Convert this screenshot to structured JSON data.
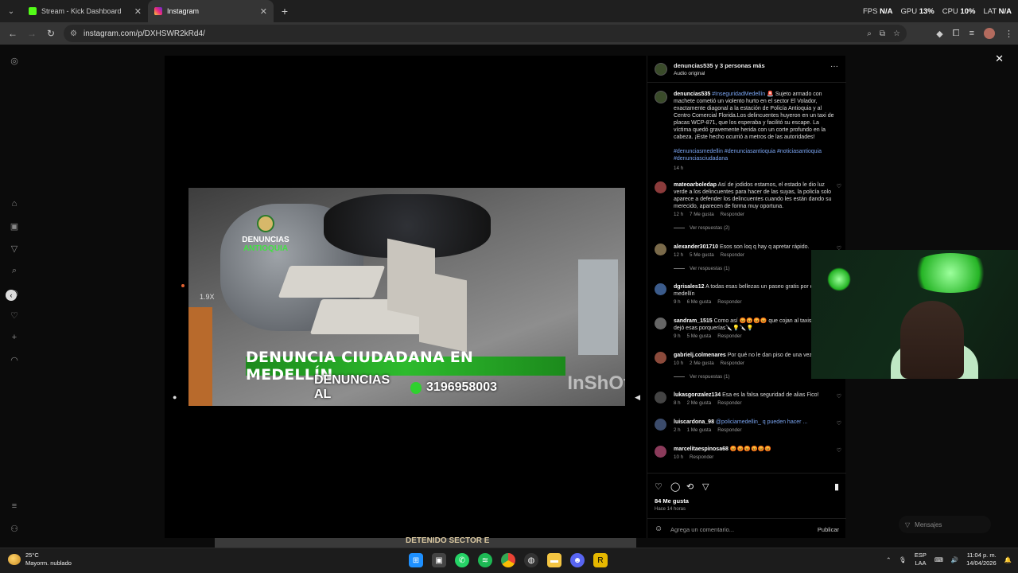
{
  "browser": {
    "tabs": [
      {
        "label": "Stream - Kick Dashboard",
        "favicon_color": "#53fc18",
        "active": false
      },
      {
        "label": "Instagram",
        "favicon_color": "#d62976",
        "active": true
      }
    ],
    "new_tab": "+",
    "url": "instagram.com/p/DXHSWR2kRd4/",
    "stats": {
      "fps_label": "FPS",
      "fps": "N/A",
      "gpu_label": "GPU",
      "gpu": "13%",
      "cpu_label": "CPU",
      "cpu": "10%",
      "lat_label": "LAT",
      "lat": "N/A"
    }
  },
  "player": {
    "speed": "1.9X",
    "watermark_line1": "DENUNCIAS",
    "watermark_line2": "ANTIOQUIA",
    "banner": "DENUNCIA CIUDADANA EN MEDELLÍN",
    "banner_phone_prefix": "DENUNCIAS AL",
    "banner_phone": "3196958003",
    "inshot": "InShOt",
    "bottom_text": "DETENIDO SECTOR E"
  },
  "post": {
    "header_user": "denuncias535 y 3 personas más",
    "header_audio": "Audio original",
    "caption_user": "denuncias535",
    "caption_tag": "#InseguridadMedellín",
    "caption_text": "🚨 Sujeto armado con machete cometió un violento hurto en el sector El Volador, exactamente diagonal a la estación de Policía Antioquia y al Centro Comercial Florida.Los delincuentes huyeron en un taxi de placas WCP-871, que los esperaba y facilitó su escape. La víctima quedó gravemente herida con un corte profundo en la cabeza. ¡Este hecho ocurrió a metros de las autoridades!",
    "caption_hashtags": "#denunciasmedellin #denunciasantioquia #noticiasantioquia #denunciasciudadana",
    "caption_time": "14 h",
    "comments": [
      {
        "user": "mateoarboledap",
        "text": "Así de jodidos estamos, el estado le dio luz verde a los delincuentes para hacer de las suyas, la policía solo aparece a defender los delincuentes cuando les están dando su merecido, aparecen de forma muy oportuna.",
        "time": "12 h",
        "likes": "7 Me gusta",
        "reply": "Responder",
        "replies": "Ver respuestas (2)",
        "color": "#8b3b3b"
      },
      {
        "user": "alexander301710",
        "text": "Esos son loq q hay q apretar rápido.",
        "time": "12 h",
        "likes": "5 Me gusta",
        "reply": "Responder",
        "replies": "Ver respuestas (1)",
        "color": "#7a6a4a"
      },
      {
        "user": "dgrisales12",
        "text": "A todas esas bellezas un paseo gratis por el río medellín",
        "time": "9 h",
        "likes": "6 Me gusta",
        "reply": "Responder",
        "replies": "",
        "color": "#3b5b8b"
      },
      {
        "user": "sandram_1515",
        "text": "Como así 😡😡😡😡 que cojan al taxis donde dejó esas porquerías🔪💡🔪💡",
        "time": "9 h",
        "likes": "5 Me gusta",
        "reply": "Responder",
        "replies": "",
        "color": "#666"
      },
      {
        "user": "gabrielj.colmenares",
        "text": "Por qué no le dan piso de una vez?",
        "time": "10 h",
        "likes": "2 Me gusta",
        "reply": "Responder",
        "replies": "Ver respuestas (1)",
        "color": "#8b4a3b"
      },
      {
        "user": "lukasgonzalez134",
        "text": "Esa es la falsa seguridad de alias Fico!",
        "time": "8 h",
        "likes": "2 Me gusta",
        "reply": "Responder",
        "replies": "",
        "color": "#444"
      },
      {
        "user": "luiscardona_98",
        "text": "@policiamedellin_ q pueden hacer ...",
        "time": "2 h",
        "likes": "1 Me gusta",
        "reply": "Responder",
        "replies": "",
        "color": "#3b4b6b"
      },
      {
        "user": "marcelitaespinosa68",
        "text": "😡😡😡😡😡😡",
        "time": "10 h",
        "likes": "",
        "reply": "Responder",
        "replies": "",
        "color": "#8b3b5b"
      }
    ],
    "likes": "84 Me gusta",
    "posted_ago": "Hace 14 horas",
    "add_comment_placeholder": "Agrega un comentario...",
    "publish": "Publicar"
  },
  "messages_label": "Mensajes",
  "taskbar": {
    "weather_temp": "25°C",
    "weather_desc": "Mayorm. nublado",
    "lang_line1": "ESP",
    "lang_line2": "LAA",
    "time": "11:04 p. m.",
    "date": "14/04/2026"
  }
}
